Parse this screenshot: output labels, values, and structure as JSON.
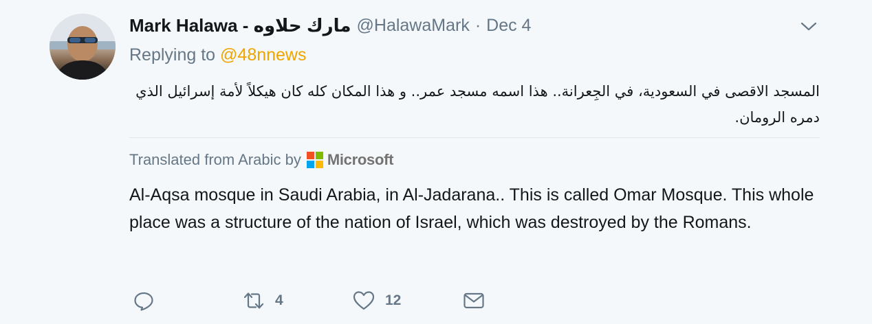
{
  "tweet": {
    "author_name": "Mark Halawa - مارك حلاوه",
    "handle": "@HalawaMark",
    "separator": "·",
    "date": "Dec 4",
    "replying_prefix": "Replying to",
    "replying_handle": "@48nnews",
    "text_original": "المسجد الاقصى في السعودية، في الجِعرانة.. هذا اسمه مسجد عمر.. و هذا المكان كله كان هيكلاً لأمة إسرائيل الذي دمره الرومان.",
    "translation_label": "Translated from Arabic by",
    "translator": "Microsoft",
    "text_translated": "Al-Aqsa mosque in Saudi Arabia, in Al-Jadarana.. This is called Omar Mosque. This whole place was a structure of the nation of Israel, which was destroyed by the Romans."
  },
  "actions": {
    "reply": {
      "icon": "reply-icon",
      "count": ""
    },
    "retweet": {
      "icon": "retweet-icon",
      "count": "4"
    },
    "like": {
      "icon": "heart-icon",
      "count": "12"
    },
    "message": {
      "icon": "envelope-icon",
      "count": ""
    }
  },
  "colors": {
    "background": "#f5f8fa",
    "text": "#14171a",
    "secondary": "#657786",
    "mention": "#f0a400",
    "divider": "#e1e8ed",
    "ms_red": "#f25022",
    "ms_green": "#7fba00",
    "ms_blue": "#00a4ef",
    "ms_yellow": "#ffb900"
  }
}
